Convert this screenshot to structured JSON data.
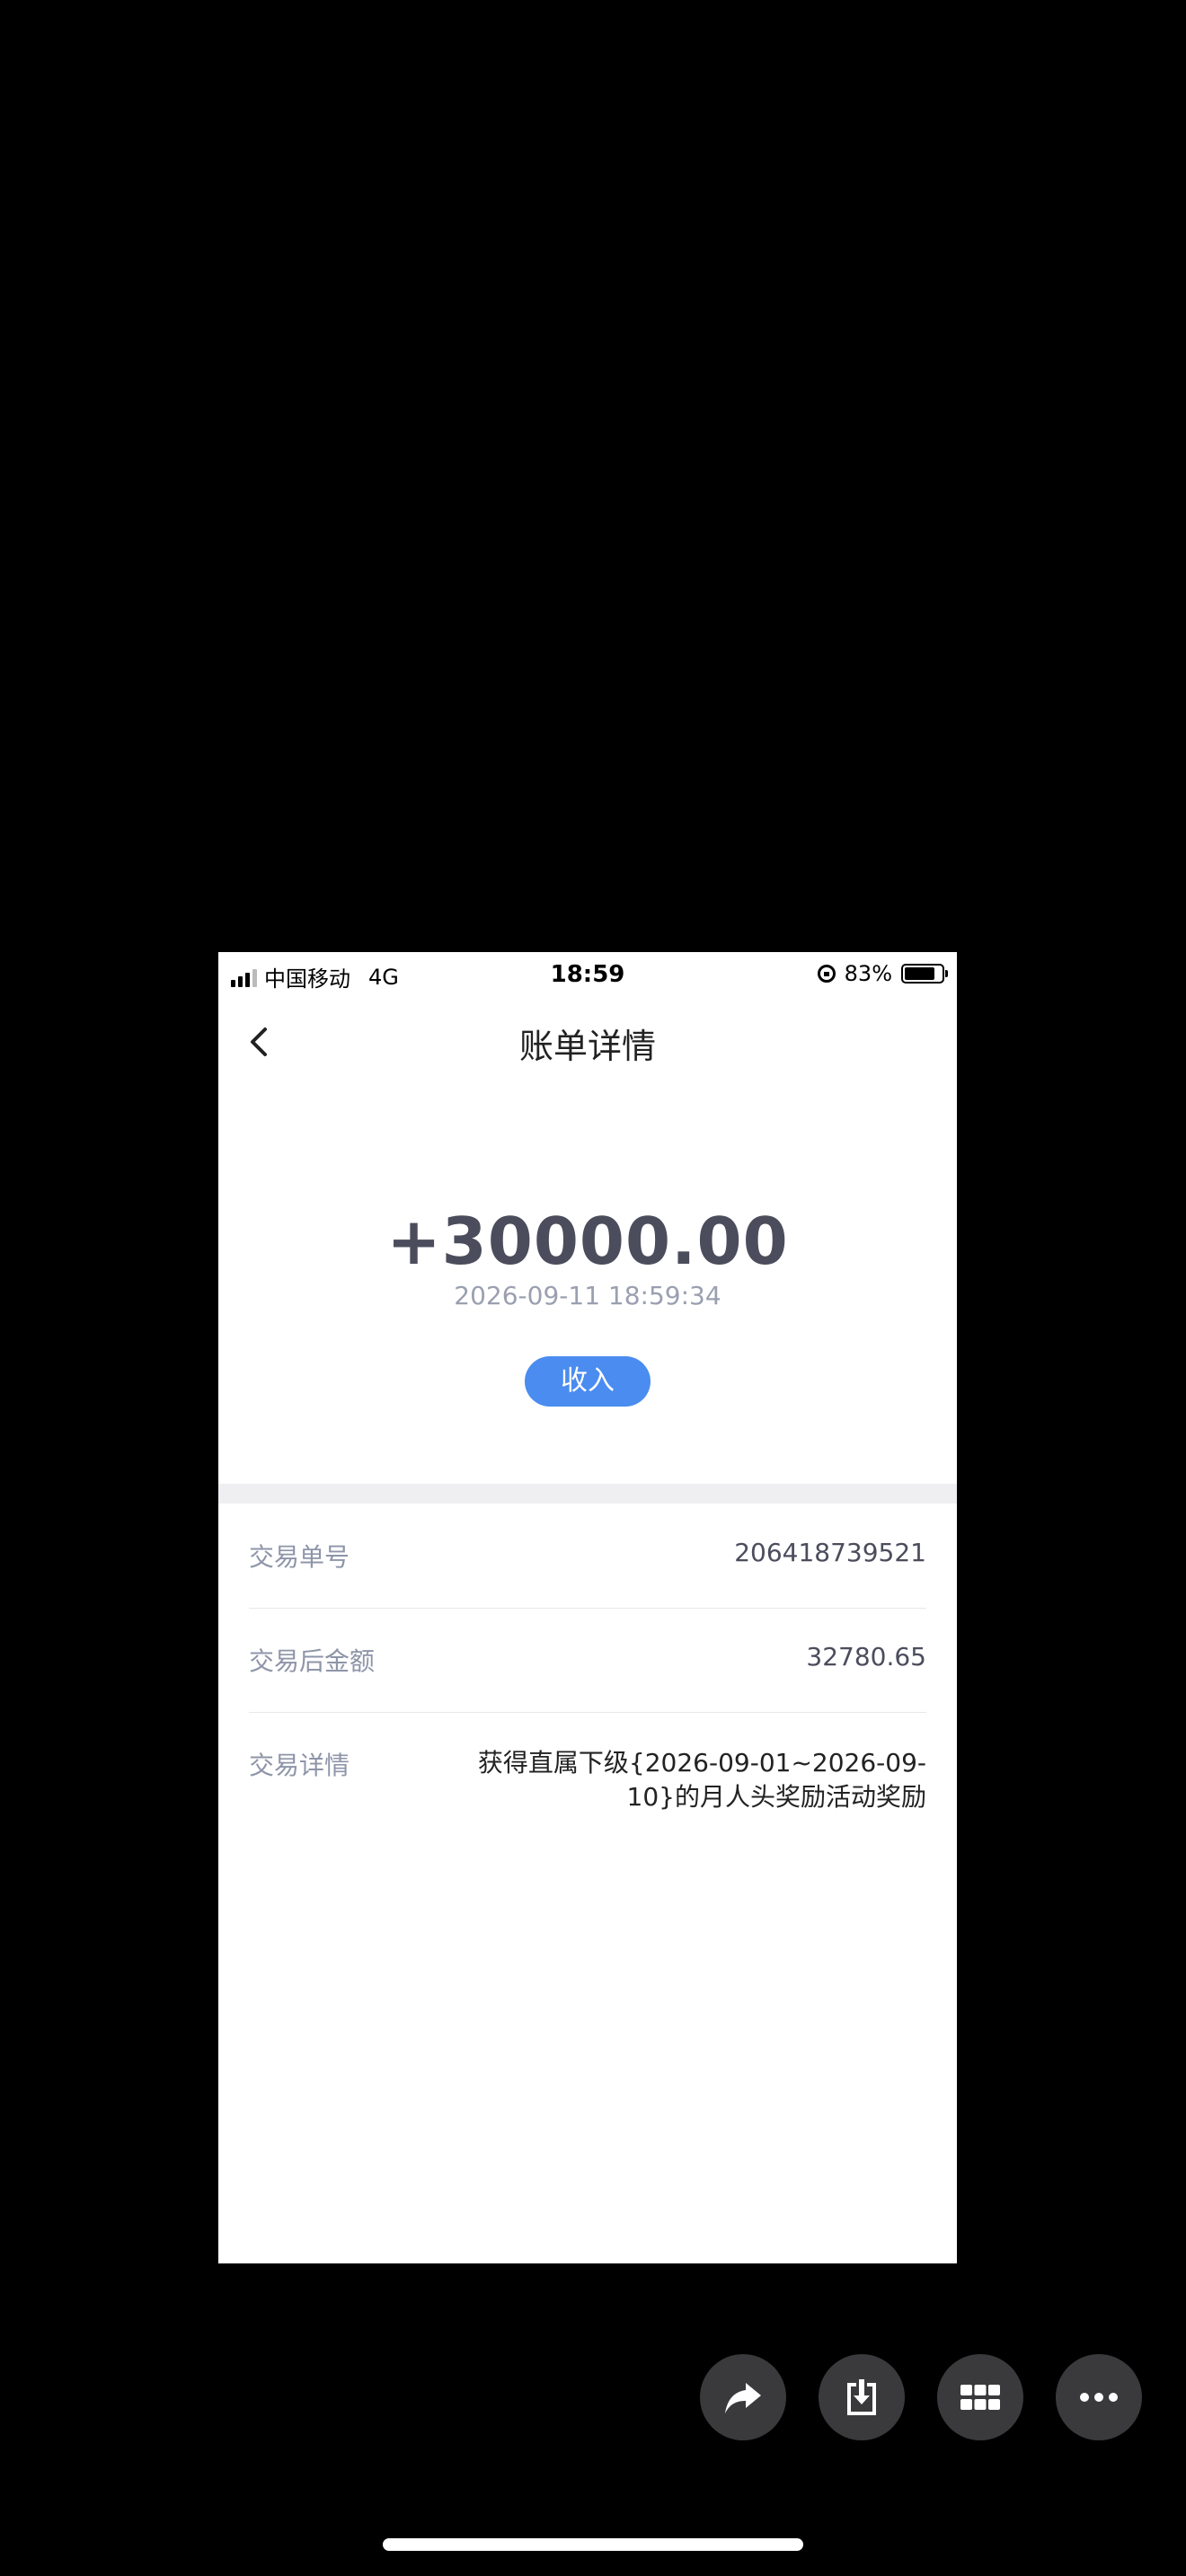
{
  "status_bar": {
    "carrier": "中国移动",
    "network": "4G",
    "time": "18:59",
    "battery": "83%",
    "battery_level": 0.83
  },
  "nav": {
    "title": "账单详情",
    "back_icon": "chevron-left-icon"
  },
  "transaction": {
    "amount": "+30000.00",
    "datetime": "2026-09-11 18:59:34",
    "type_badge": "收入",
    "badge_color": "#4a8cf0"
  },
  "details": [
    {
      "label": "交易单号",
      "value": "206418739521"
    },
    {
      "label": "交易后金额",
      "value": "32780.65"
    },
    {
      "label": "交易详情",
      "value": "获得直属下级{2026-09-01~2026-09-10}的月人头奖励活动奖励"
    }
  ],
  "viewer_actions": [
    {
      "name": "share",
      "icon": "share-icon"
    },
    {
      "name": "save",
      "icon": "download-icon"
    },
    {
      "name": "grid",
      "icon": "grid-icon"
    },
    {
      "name": "more",
      "icon": "more-icon"
    }
  ]
}
